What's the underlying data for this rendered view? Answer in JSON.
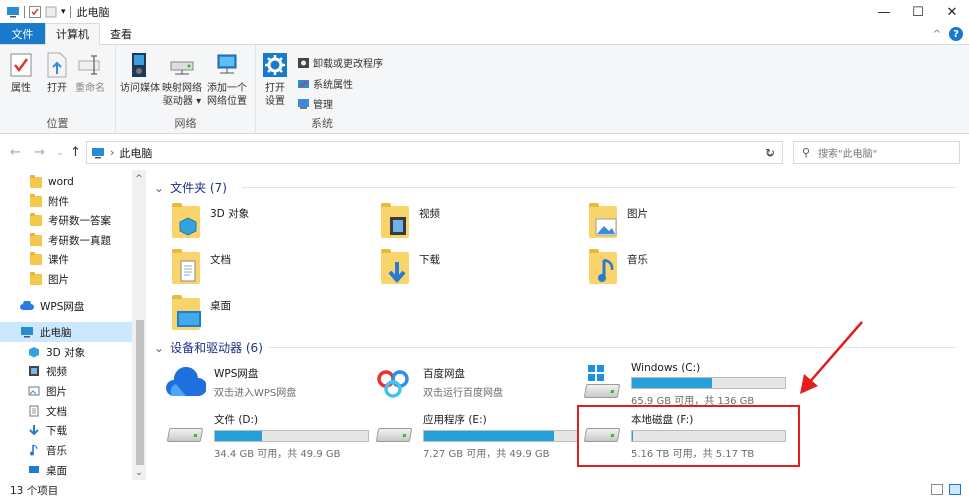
{
  "window": {
    "title": "此电脑",
    "controls": {
      "minimize": "—",
      "maximize": "☐",
      "close": "✕"
    }
  },
  "ribbon_tabs": {
    "file": "文件",
    "computer": "计算机",
    "view": "查看",
    "collapse": "^",
    "help": "?"
  },
  "ribbon": {
    "location_group": {
      "label": "位置",
      "properties": "属性",
      "open": "打开",
      "rename": "重命名"
    },
    "network_group": {
      "label": "网络",
      "access_media": "访问媒体",
      "map_drive_1": "映射网络",
      "map_drive_2": "驱动器 ▾",
      "add_location_1": "添加一个",
      "add_location_2": "网络位置"
    },
    "system_group": {
      "label": "系统",
      "open_settings_1": "打开",
      "open_settings_2": "设置",
      "uninstall": "卸载或更改程序",
      "system_props": "系统属性",
      "manage": "管理"
    }
  },
  "address": {
    "path": "此电脑",
    "separator": "›",
    "search_placeholder": "搜索\"此电脑\""
  },
  "nav_pane": {
    "items": [
      {
        "label": "word"
      },
      {
        "label": "附件"
      },
      {
        "label": "考研数一答案"
      },
      {
        "label": "考研数一真题"
      },
      {
        "label": "课件"
      },
      {
        "label": "图片"
      },
      {
        "label": "WPS网盘"
      },
      {
        "label": "此电脑"
      },
      {
        "label": "3D 对象"
      },
      {
        "label": "视频"
      },
      {
        "label": "图片"
      },
      {
        "label": "文档"
      },
      {
        "label": "下载"
      },
      {
        "label": "音乐"
      },
      {
        "label": "桌面"
      }
    ]
  },
  "content": {
    "folders_header": "文件夹 (7)",
    "folders": [
      {
        "label": "3D 对象"
      },
      {
        "label": "视频"
      },
      {
        "label": "图片"
      },
      {
        "label": "文档"
      },
      {
        "label": "下载"
      },
      {
        "label": "音乐"
      },
      {
        "label": "桌面"
      }
    ],
    "devices_header": "设备和驱动器 (6)",
    "devices": [
      {
        "name": "WPS网盘",
        "sub": "双击进入WPS网盘"
      },
      {
        "name": "百度网盘",
        "sub": "双击运行百度网盘"
      },
      {
        "name": "Windows (C:)",
        "sub": "65.9 GB 可用，共 136 GB",
        "used_fraction": 0.52
      },
      {
        "name": "文件 (D:)",
        "sub": "34.4 GB 可用，共 49.9 GB",
        "used_fraction": 0.31
      },
      {
        "name": "应用程序 (E:)",
        "sub": "7.27 GB 可用，共 49.9 GB",
        "used_fraction": 0.85
      },
      {
        "name": "本地磁盘 (F:)",
        "sub": "5.16 TB 可用，共 5.17 TB",
        "used_fraction": 0.002
      }
    ]
  },
  "status": {
    "count": "13 个项目"
  },
  "colors": {
    "accent": "#1979ca",
    "drive_bar": "#26a0da",
    "highlight": "#e21e1e",
    "selected": "#cce8ff"
  }
}
